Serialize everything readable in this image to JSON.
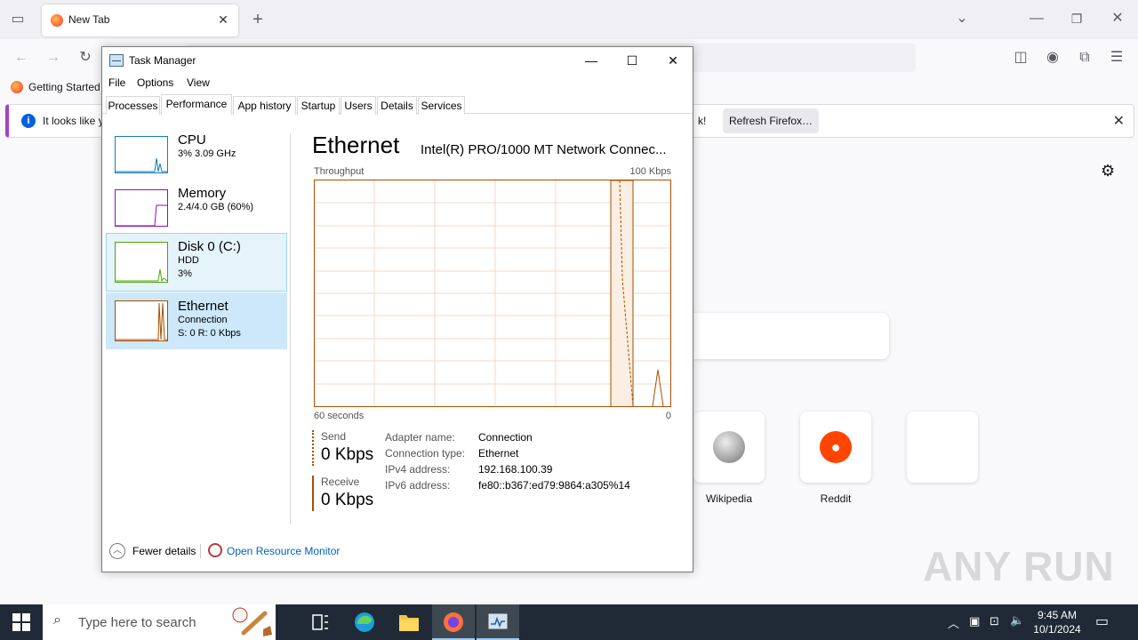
{
  "browser": {
    "tab_title": "New Tab",
    "bookmark": "Getting Started",
    "notification": {
      "message_start": "It looks like y",
      "message_end": "k!",
      "button": "Refresh Firefox…"
    },
    "tiles": [
      {
        "label": "Wikipedia"
      },
      {
        "label": "Reddit"
      },
      {
        "label": ""
      }
    ],
    "watermark": "ANY RUN"
  },
  "task_manager": {
    "title": "Task Manager",
    "menu": [
      "File",
      "Options",
      "View"
    ],
    "tabs": [
      "Processes",
      "Performance",
      "App history",
      "Startup",
      "Users",
      "Details",
      "Services"
    ],
    "active_tab": "Performance",
    "sidebar": [
      {
        "name": "CPU",
        "sub1": "3% 3.09 GHz",
        "sub2": "",
        "color": "#117dbb"
      },
      {
        "name": "Memory",
        "sub1": "2.4/4.0 GB (60%)",
        "sub2": "",
        "color": "#8b12ae"
      },
      {
        "name": "Disk 0 (C:)",
        "sub1": "HDD",
        "sub2": "3%",
        "color": "#4da60c"
      },
      {
        "name": "Ethernet",
        "sub1": "Connection",
        "sub2": "S: 0 R: 0 Kbps",
        "color": "#a74f01"
      }
    ],
    "detail": {
      "heading": "Ethernet",
      "adapter": "Intel(R) PRO/1000 MT Network Connec...",
      "graph_label": "Throughput",
      "graph_max": "100 Kbps",
      "graph_time": "60 seconds",
      "graph_min": "0",
      "send_label": "Send",
      "send_value": "0 Kbps",
      "receive_label": "Receive",
      "receive_value": "0 Kbps",
      "properties": [
        {
          "key": "Adapter name:",
          "value": "Connection"
        },
        {
          "key": "Connection type:",
          "value": "Ethernet"
        },
        {
          "key": "IPv4 address:",
          "value": "192.168.100.39"
        },
        {
          "key": "IPv6 address:",
          "value": "fe80::b367:ed79:9864:a305%14"
        }
      ]
    },
    "footer": {
      "fewer_details": "Fewer details",
      "resource_monitor": "Open Resource Monitor"
    }
  },
  "taskbar": {
    "search_placeholder": "Type here to search",
    "time": "9:45 AM",
    "date": "10/1/2024"
  }
}
